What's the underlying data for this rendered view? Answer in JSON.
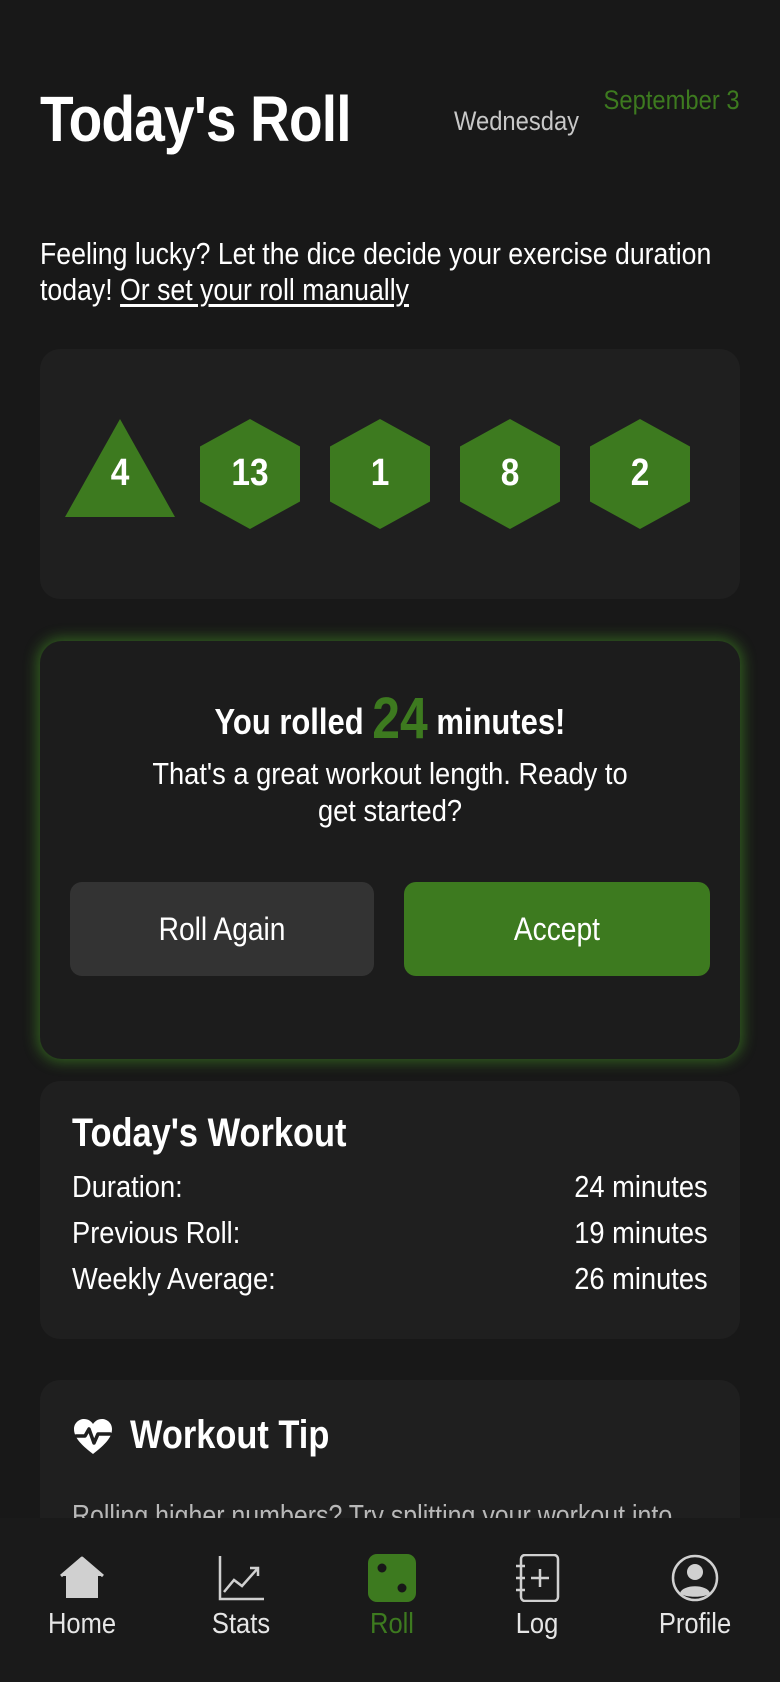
{
  "header": {
    "title": "Today's Roll",
    "weekday": "Wednesday",
    "date": "September 3"
  },
  "intro": {
    "text": "Feeling lucky? Let the dice decide your exercise duration today!",
    "link": "Or set your roll manually"
  },
  "dice": [
    {
      "shape": "triangle",
      "value": "4"
    },
    {
      "shape": "hexagon",
      "value": "13"
    },
    {
      "shape": "hexagon",
      "value": "1"
    },
    {
      "shape": "hexagon",
      "value": "8"
    },
    {
      "shape": "hexagon",
      "value": "2"
    }
  ],
  "result": {
    "prefix": "You rolled",
    "value": "24",
    "suffix": "minutes!",
    "message": "That's a great workout length. Ready to get started?",
    "roll_again_label": "Roll Again",
    "accept_label": "Accept"
  },
  "workout": {
    "title": "Today's Workout",
    "rows": [
      {
        "label": "Duration:",
        "value": "24 minutes"
      },
      {
        "label": "Previous Roll:",
        "value": "19 minutes"
      },
      {
        "label": "Weekly Average:",
        "value": "26 minutes"
      }
    ]
  },
  "tip": {
    "title": "Workout Tip",
    "text": "Rolling higher numbers? Try splitting your workout into"
  },
  "nav": {
    "items": [
      {
        "label": "Home",
        "icon": "home-icon"
      },
      {
        "label": "Stats",
        "icon": "chart-icon"
      },
      {
        "label": "Roll",
        "icon": "dice-icon",
        "active": true
      },
      {
        "label": "Log",
        "icon": "log-add-icon"
      },
      {
        "label": "Profile",
        "icon": "profile-icon"
      }
    ]
  },
  "colors": {
    "accent": "#3d7a1f",
    "background": "#181818",
    "card": "#1f1f1f",
    "secondary_button": "#333333"
  }
}
